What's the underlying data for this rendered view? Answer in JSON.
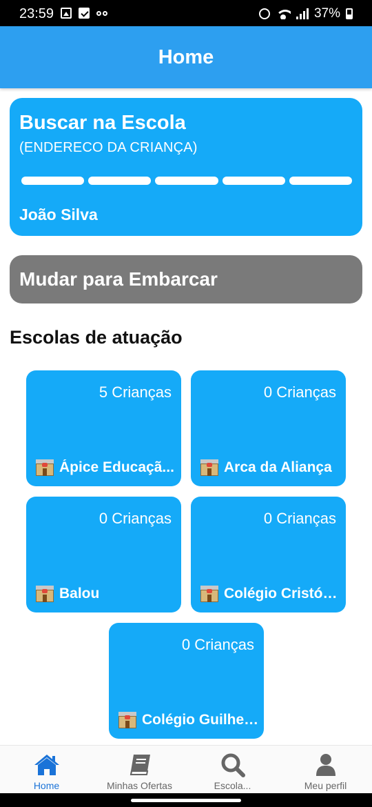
{
  "status_bar": {
    "time": "23:59",
    "battery": "37%"
  },
  "app_bar": {
    "title": "Home"
  },
  "trip_card": {
    "title": "Buscar na Escola",
    "address": "(ENDERECO DA CRIANÇA)",
    "driver": "João Silva",
    "progress_segments": 5
  },
  "switch_button": {
    "label": "Mudar para Embarcar"
  },
  "schools": {
    "title": "Escolas de atuação",
    "items": [
      {
        "count": "5 Crianças",
        "name": "Ápice Educaçã..."
      },
      {
        "count": "0 Crianças",
        "name": "Arca da Aliança"
      },
      {
        "count": "0 Crianças",
        "name": "Balou"
      },
      {
        "count": "0 Crianças",
        "name": "Colégio Cristóvã..."
      },
      {
        "count": "0 Crianças",
        "name": "Colégio Guilherm..."
      }
    ]
  },
  "bottom_nav": {
    "items": [
      {
        "label": "Home",
        "icon": "home-icon",
        "active": true
      },
      {
        "label": "Minhas Ofertas",
        "icon": "book-icon",
        "active": false
      },
      {
        "label": "Escola...",
        "icon": "search-icon",
        "active": false
      },
      {
        "label": "Meu perfil",
        "icon": "person-icon",
        "active": false
      }
    ]
  },
  "colors": {
    "primary": "#15aaf8",
    "app_bar": "#2d9ff0",
    "switch_button": "#7a7a7a",
    "nav_active": "#1a73d8",
    "nav_inactive": "#666666"
  }
}
